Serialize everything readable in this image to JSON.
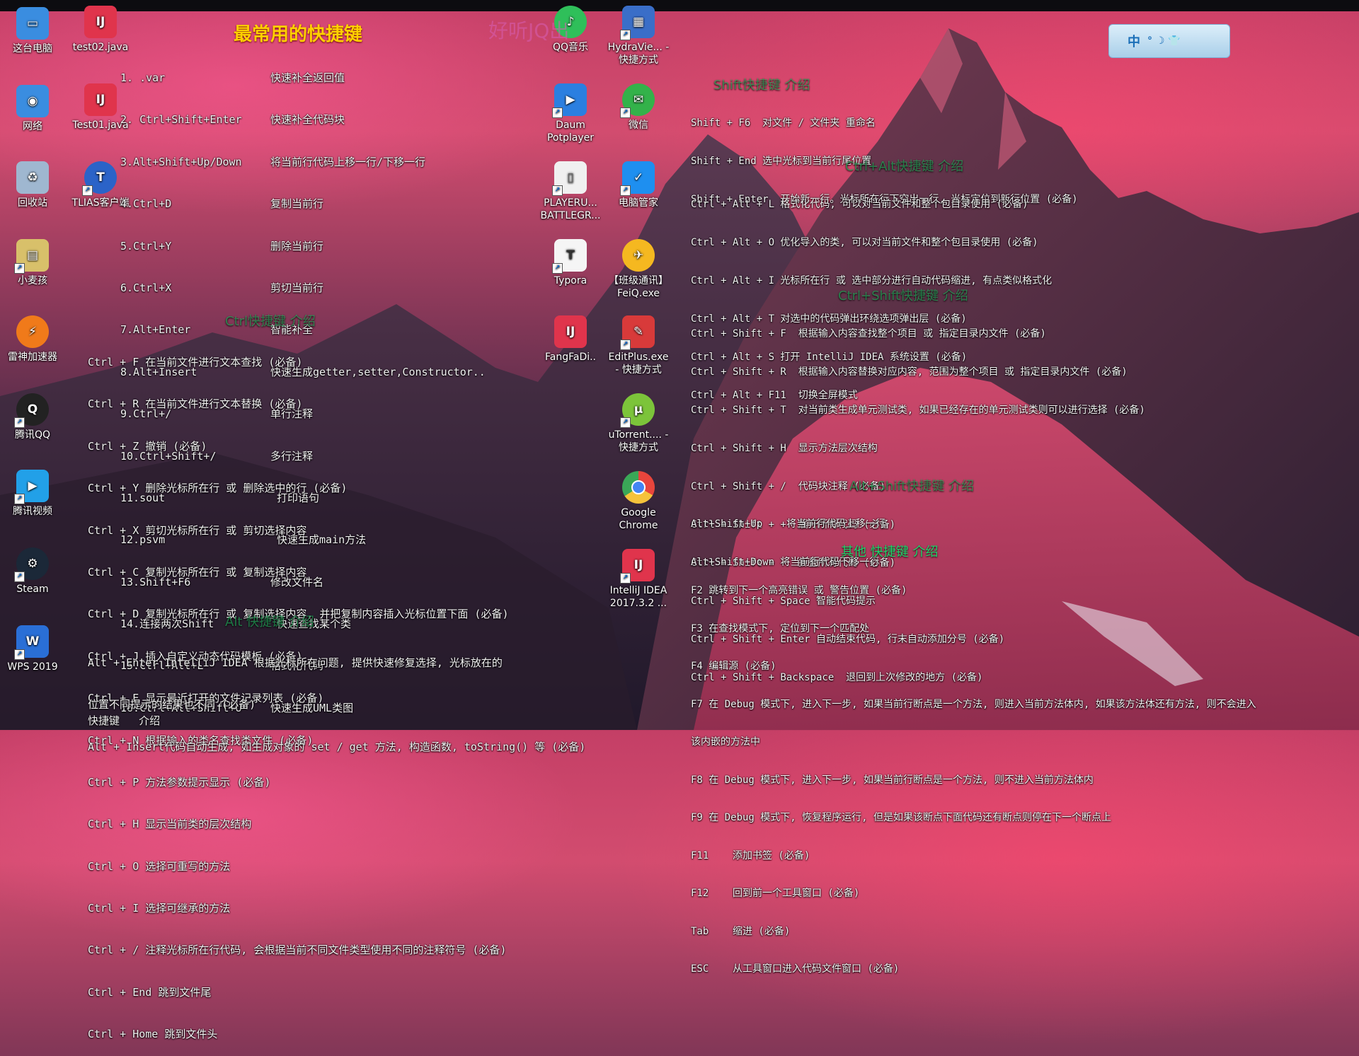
{
  "desktop_icons": [
    {
      "label": "这台电脑",
      "icon": "computer-icon",
      "color": "#3a8de0"
    },
    {
      "label": "网络",
      "icon": "network-icon",
      "color": "#3a8de0"
    },
    {
      "label": "回收站",
      "icon": "recycle-bin-icon",
      "color": "#9fb7d0"
    },
    {
      "label": "小麦孩",
      "icon": "folder-icon",
      "color": "#d8c06a"
    },
    {
      "label": "雷神加速器",
      "icon": "leishen-icon",
      "color": "#f07a1a"
    },
    {
      "label": "腾讯QQ",
      "icon": "qq-icon",
      "color": "#222222"
    },
    {
      "label": "腾讯视频",
      "icon": "tencent-video-icon",
      "color": "#22a0e8"
    },
    {
      "label": "Steam",
      "icon": "steam-icon",
      "color": "#1b2838"
    },
    {
      "label": "WPS 2019",
      "icon": "wps-icon",
      "color": "#2a6fd6"
    },
    {
      "label": "test02.java",
      "icon": "intellij-file-icon",
      "color": "#e0344c"
    },
    {
      "label": "Test01.java",
      "icon": "intellij-file-icon",
      "color": "#e0344c"
    },
    {
      "label": "TLIAS客户端",
      "icon": "tlias-icon",
      "color": "#2b63c8"
    },
    {
      "label": "QQ音乐",
      "icon": "qq-music-icon",
      "color": "#2fbf5a"
    },
    {
      "label": "Daum Potplayer",
      "icon": "potplayer-icon",
      "color": "#2b7fe0"
    },
    {
      "label": "PLAYERU... BATTLEGR...",
      "icon": "file-icon",
      "color": "#f0f0f0"
    },
    {
      "label": "Typora",
      "icon": "typora-icon",
      "color": "#f5f5f5"
    },
    {
      "label": "FangFaDi..",
      "icon": "intellij-icon",
      "color": "#e0344c"
    },
    {
      "label": "HydraVie... - 快捷方式",
      "icon": "hydravision-icon",
      "color": "#3a6ec8"
    },
    {
      "label": "微信",
      "icon": "wechat-icon",
      "color": "#33b24a"
    },
    {
      "label": "电脑管家",
      "icon": "pc-manager-icon",
      "color": "#1e8ff0"
    },
    {
      "label": "【班级通讯】 FeiQ.exe",
      "icon": "feiq-icon",
      "color": "#f5b820"
    },
    {
      "label": "EditPlus.exe - 快捷方式",
      "icon": "editplus-icon",
      "color": "#d83a3a"
    },
    {
      "label": "uTorrent.... - 快捷方式",
      "icon": "utorrent-icon",
      "color": "#7cc43a"
    },
    {
      "label": "Google Chrome",
      "icon": "chrome-icon",
      "color": "#e8453c"
    },
    {
      "label": "IntelliJ IDEA 2017.3.2 ...",
      "icon": "intellij-icon",
      "color": "#e0344c"
    }
  ],
  "main_title": "最常用的快捷键",
  "ghost_title": "好听JQ出",
  "top_list": [
    {
      "key": "1. .var",
      "desc": "快速补全返回值"
    },
    {
      "key": "2. Ctrl+Shift+Enter",
      "desc": "快速补全代码块"
    },
    {
      "key": "3.Alt+Shift+Up/Down",
      "desc": "将当前行代码上移一行/下移一行"
    },
    {
      "key": "4.Ctrl+D",
      "desc": "复制当前行"
    },
    {
      "key": "5.Ctrl+Y",
      "desc": "删除当前行"
    },
    {
      "key": "6.Ctrl+X",
      "desc": "剪切当前行"
    },
    {
      "key": "7.Alt+Enter",
      "desc": "智能补全"
    },
    {
      "key": "8.Alt+Insert",
      "desc": "快速生成getter,setter,Constructor.."
    },
    {
      "key": "9.Ctrl+/",
      "desc": "单行注释"
    },
    {
      "key": "10.Ctrl+Shift+/",
      "desc": "多行注释"
    },
    {
      "key": "11.sout",
      "desc": " 打印语句"
    },
    {
      "key": "12.psvm",
      "desc": " 快速生成main方法"
    },
    {
      "key": "13.Shift+F6",
      "desc": "修改文件名"
    },
    {
      "key": "14.连接两次Shift",
      "desc": " 快速查找某个类"
    },
    {
      "key": "15.Ctrl+Alt+L",
      "desc": "格式化代码"
    },
    {
      "key": "16.Ctrl+Alt+Shift+U",
      "desc": "快速生成UML类图"
    }
  ],
  "ctrl_section": {
    "title": "Ctrl快捷键  介绍",
    "lines": [
      "Ctrl + F 在当前文件进行文本查找 (必备)",
      "Ctrl + R 在当前文件进行文本替换 (必备)",
      "Ctrl + Z 撤销 (必备)",
      "Ctrl + Y 删除光标所在行 或 删除选中的行 (必备)",
      "Ctrl + X 剪切光标所在行 或 剪切选择内容",
      "Ctrl + C 复制光标所在行 或 复制选择内容",
      "Ctrl + D 复制光标所在行 或 复制选择内容, 并把复制内容插入光标位置下面 (必备)",
      "Ctrl + J 插入自定义动态代码模板 (必备)",
      "Ctrl + E 显示最近打开的文件记录列表 (必备)",
      "Ctrl + N 根据输入的类名查找类文件 (必备)",
      "Ctrl + P 方法参数提示显示 (必备)",
      "Ctrl + H 显示当前类的层次结构",
      "Ctrl + O 选择可重写的方法",
      "Ctrl + I 选择可继承的方法",
      "Ctrl + / 注释光标所在行代码, 会根据当前不同文件类型使用不同的注释符号 (必备)",
      "Ctrl + End 跳到文件尾",
      "Ctrl + Home 跳到文件头"
    ]
  },
  "alt_section": {
    "title": "Alt  快捷键  介绍",
    "lines": [
      "Alt + Enter IntelliJ IDEA 根据光标所在问题, 提供快速修复选择, 光标放在的",
      "位置不同提示的结果也不同 (必备)",
      "Alt + Insert代码自动生成, 如生成对象的 set / get 方法, 构造函数, toString() 等 (必备)"
    ],
    "footer": "快捷键   介绍"
  },
  "shift_section": {
    "title": "Shift快捷键  介绍",
    "lines": [
      "Shift + F6  对文件 / 文件夹 重命名",
      "Shift + End 选中光标到当前行尾位置",
      "Shift + Enter  开始新一行。光标所在行下空出一行, 光标定位到新行位置 (必备)"
    ]
  },
  "ctrl_alt_section": {
    "title": "Ctrl+Alt快捷键  介绍",
    "lines": [
      "Ctrl + Alt + L 格式化代码, 可以对当前文件和整个包目录使用 (必备)",
      "Ctrl + Alt + O 优化导入的类, 可以对当前文件和整个包目录使用 (必备)",
      "Ctrl + Alt + I 光标所在行 或 选中部分进行自动代码缩进, 有点类似格式化",
      "Ctrl + Alt + T 对选中的代码弹出环绕选项弹出层 (必备)",
      "Ctrl + Alt + S 打开 IntelliJ IDEA 系统设置 (必备)",
      "Ctrl + Alt + F11  切换全屏模式"
    ]
  },
  "ctrl_shift_section": {
    "title": "Ctrl+Shift快捷键  介绍",
    "lines": [
      "Ctrl + Shift + F  根据输入内容查找整个项目 或 指定目录内文件 (必备)",
      "Ctrl + Shift + R  根据输入内容替换对应内容, 范围为整个项目 或 指定目录内文件 (必备)",
      "Ctrl + Shift + T  对当前类生成单元测试类, 如果已经存在的单元测试类则可以进行选择 (必备)",
      "Ctrl + Shift + H  显示方法层次结构",
      "Ctrl + Shift + /  代码块注释 (必备)",
      "Ctrl + Shift + +  展开所有代码 (必备)",
      "Ctrl + Shift + -  折叠所有代码 (必备)",
      "Ctrl + Shift + Space 智能代码提示",
      "Ctrl + Shift + Enter 自动结束代码, 行末自动添加分号 (必备)",
      "Ctrl + Shift + Backspace  退回到上次修改的地方 (必备)"
    ]
  },
  "alt_shift_section": {
    "title": "Alt+Shift快捷键  介绍",
    "lines": [
      "Alt+Shift+Up    将当前行代码上移一行",
      "Alt+Shift+Down 将当前行代码下移一行"
    ]
  },
  "other_section": {
    "title": "其他  快捷键  介绍",
    "lines": [
      "F2 跳转到下一个高亮错误 或 警告位置 (必备)",
      "F3 在查找模式下, 定位到下一个匹配处",
      "F4 编辑源 (必备)",
      "F7 在 Debug 模式下, 进入下一步, 如果当前行断点是一个方法, 则进入当前方法体内, 如果该方法体还有方法, 则不会进入",
      "该内嵌的方法中",
      "F8 在 Debug 模式下, 进入下一步, 如果当前行断点是一个方法, 则不进入当前方法体内",
      "F9 在 Debug 模式下, 恢复程序运行, 但是如果该断点下面代码还有断点则停在下一个断点上",
      "F11    添加书签 (必备)",
      "F12    回到前一个工具窗口 (必备)",
      "Tab    缩进 (必备)",
      "ESC    从工具窗口进入代码文件窗口 (必备)"
    ]
  },
  "ime_widget": {
    "text": "中",
    "extras": "° ☽ 👕"
  }
}
